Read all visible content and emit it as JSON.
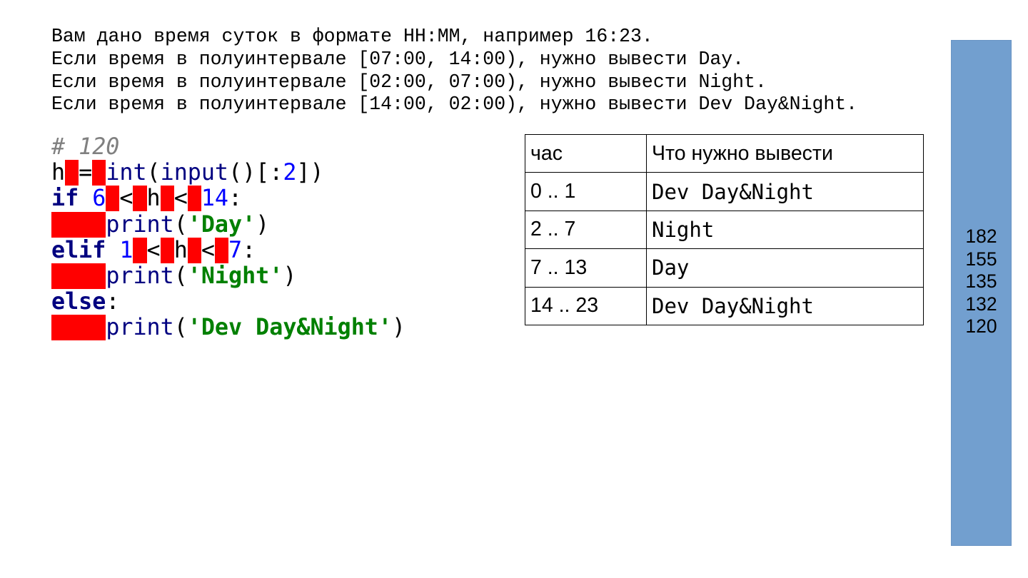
{
  "task": {
    "lines": [
      "Вам дано время суток в формате HH:MM, например 16:23.",
      "Если время в полуинтервале [07:00, 14:00), нужно вывести Day.",
      "Если время в полуинтервале [02:00, 07:00), нужно вывести Night.",
      "Если время в полуинтервале [14:00, 02:00), нужно вывести Dev Day&Night."
    ]
  },
  "code": {
    "comment": "# 120",
    "var_h": "h",
    "eq": "=",
    "int_fn": "int",
    "input_fn": "input",
    "paren_open": "(",
    "paren_close": ")",
    "slice_open": "()[:",
    "slice_num": "2",
    "slice_close": "])",
    "kw_if": "if",
    "kw_elif": "elif",
    "kw_else": "else",
    "lt": "<",
    "colon": ":",
    "n6": "6",
    "n14": "14",
    "n1": "1",
    "n7": "7",
    "print_fn": "print",
    "str_day": "'Day'",
    "str_night": "'Night'",
    "str_devdn": "'Dev Day&Night'"
  },
  "table": {
    "header": [
      "час",
      "Что нужно вывести"
    ],
    "rows": [
      [
        "0 .. 1",
        "Dev Day&Night"
      ],
      [
        "2 .. 7",
        "Night"
      ],
      [
        "7 .. 13",
        "Day"
      ],
      [
        "14 .. 23",
        "Dev Day&Night"
      ]
    ]
  },
  "side_panel": {
    "color": "#729fcf",
    "scores": [
      "182",
      "155",
      "135",
      "132",
      "120"
    ]
  },
  "colors": {
    "space_marker": "#ff0000",
    "keyword": "#000080",
    "number": "#0000ff",
    "string": "#008000",
    "comment": "#808080"
  }
}
